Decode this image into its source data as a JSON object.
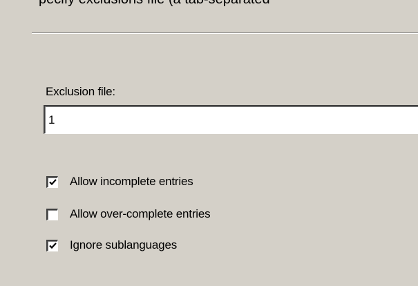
{
  "top_clipped": {
    "text": "pecify exclusions file (a tab-separated",
    "end_mark": "("
  },
  "exclusion": {
    "label": "Exclusion file:",
    "value": "1"
  },
  "options": [
    {
      "label": "Allow incomplete entries",
      "checked": true
    },
    {
      "label": "Allow over-complete entries",
      "checked": false
    },
    {
      "label": "Ignore sublanguages",
      "checked": true
    }
  ],
  "colors": {
    "background": "#d4d0c8",
    "field_background": "#ffffff",
    "text": "#000000"
  }
}
